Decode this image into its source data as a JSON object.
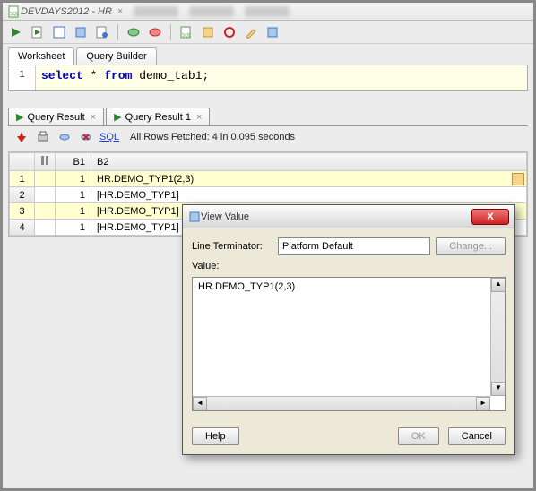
{
  "titlebar": {
    "title": "DEVDAYS2012 - HR"
  },
  "tabs": {
    "worksheet": "Worksheet",
    "querybuilder": "Query Builder"
  },
  "editor": {
    "line": "1",
    "sql_select": "select",
    "sql_star": " * ",
    "sql_from": "from",
    "sql_rest": " demo_tab1;"
  },
  "result_tabs": [
    {
      "label": "Query Result"
    },
    {
      "label": "Query Result 1"
    }
  ],
  "result_toolbar": {
    "sql_link": "SQL",
    "status": "All Rows Fetched: 4 in 0.095 seconds"
  },
  "grid": {
    "headers": {
      "corner": "",
      "b1": "B1",
      "b2": "B2"
    },
    "rows": [
      {
        "n": "1",
        "b1": "1",
        "b2": "HR.DEMO_TYP1(2,3)",
        "editing": true
      },
      {
        "n": "2",
        "b1": "1",
        "b2": "[HR.DEMO_TYP1]"
      },
      {
        "n": "3",
        "b1": "1",
        "b2": "[HR.DEMO_TYP1]"
      },
      {
        "n": "4",
        "b1": "1",
        "b2": "[HR.DEMO_TYP1]"
      }
    ]
  },
  "dialog": {
    "title": "View Value",
    "line_terminator_label": "Line Terminator:",
    "line_terminator_value": "Platform Default",
    "change": "Change...",
    "value_label": "Value:",
    "value": "HR.DEMO_TYP1(2,3)",
    "help": "Help",
    "ok": "OK",
    "cancel": "Cancel"
  },
  "icons": {
    "run": "run-icon",
    "save": "save-icon",
    "db": "db-icon"
  }
}
